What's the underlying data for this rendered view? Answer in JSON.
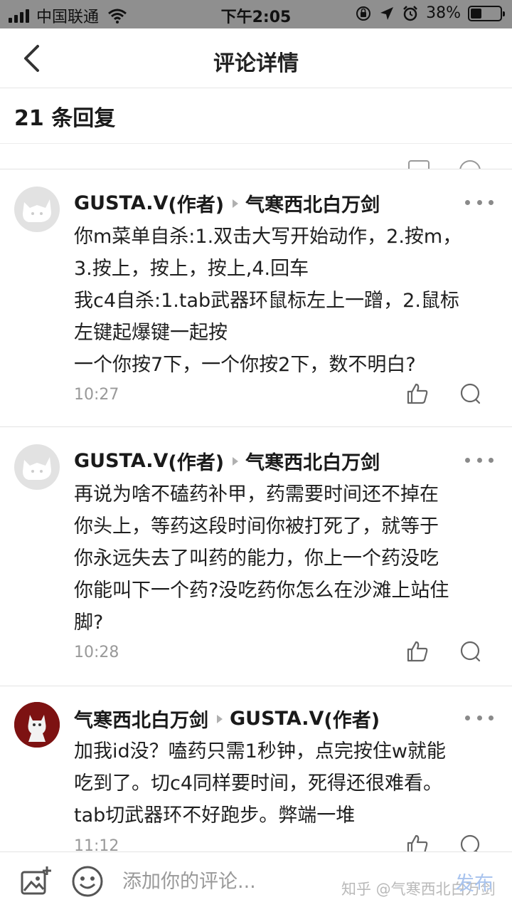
{
  "status_bar": {
    "carrier": "中国联通",
    "time": "下午2:05",
    "battery": "38%",
    "battery_level": 0.38
  },
  "header": {
    "title": "评论详情",
    "back_icon": "chevron-left-icon"
  },
  "reply_count": "21 条回复",
  "comments": [
    {
      "user": "GUSTA.V",
      "author_tag": "(作者)",
      "reply_to": "气寒西北白万剑",
      "lines": [
        "你m菜单自杀:1.双击大写开始动作，2.按m，",
        "3.按上，按上，按上,4.回车",
        "我c4自杀:1.tab武器环鼠标左上一蹭，2.鼠标",
        "左键起爆键一起按",
        "一个你按7下，一个你按2下，数不明白?"
      ],
      "time": "10:27"
    },
    {
      "user": "GUSTA.V",
      "author_tag": "(作者)",
      "reply_to": "气寒西北白万剑",
      "lines": [
        "再说为啥不磕药补甲，药需要时间还不掉在",
        "你头上，等药这段时间你被打死了，就等于",
        "你永远失去了叫药的能力，你上一个药没吃",
        "你能叫下一个药?没吃药你怎么在沙滩上站住",
        "脚?"
      ],
      "time": "10:28"
    },
    {
      "user": "气寒西北白万剑",
      "reply_to": "GUSTA.V",
      "reply_to_tag": "(作者)",
      "lines": [
        "加我id没？嗑药只需1秒钟，点完按住w就能",
        "吃到了。切c4同样要时间，死得还很难看。",
        "tab切武器环不好跑步。弊端一堆"
      ],
      "time": "11:12"
    }
  ],
  "bottom_bar": {
    "input_placeholder": "添加你的评论...",
    "publish_label": "发布",
    "watermark": "知乎 @气寒西北白万剑"
  },
  "colors": {
    "status_bar_bg": "#8f8f8f",
    "publish_disabled": "#a9c4ee",
    "secondary_text": "#999999"
  }
}
